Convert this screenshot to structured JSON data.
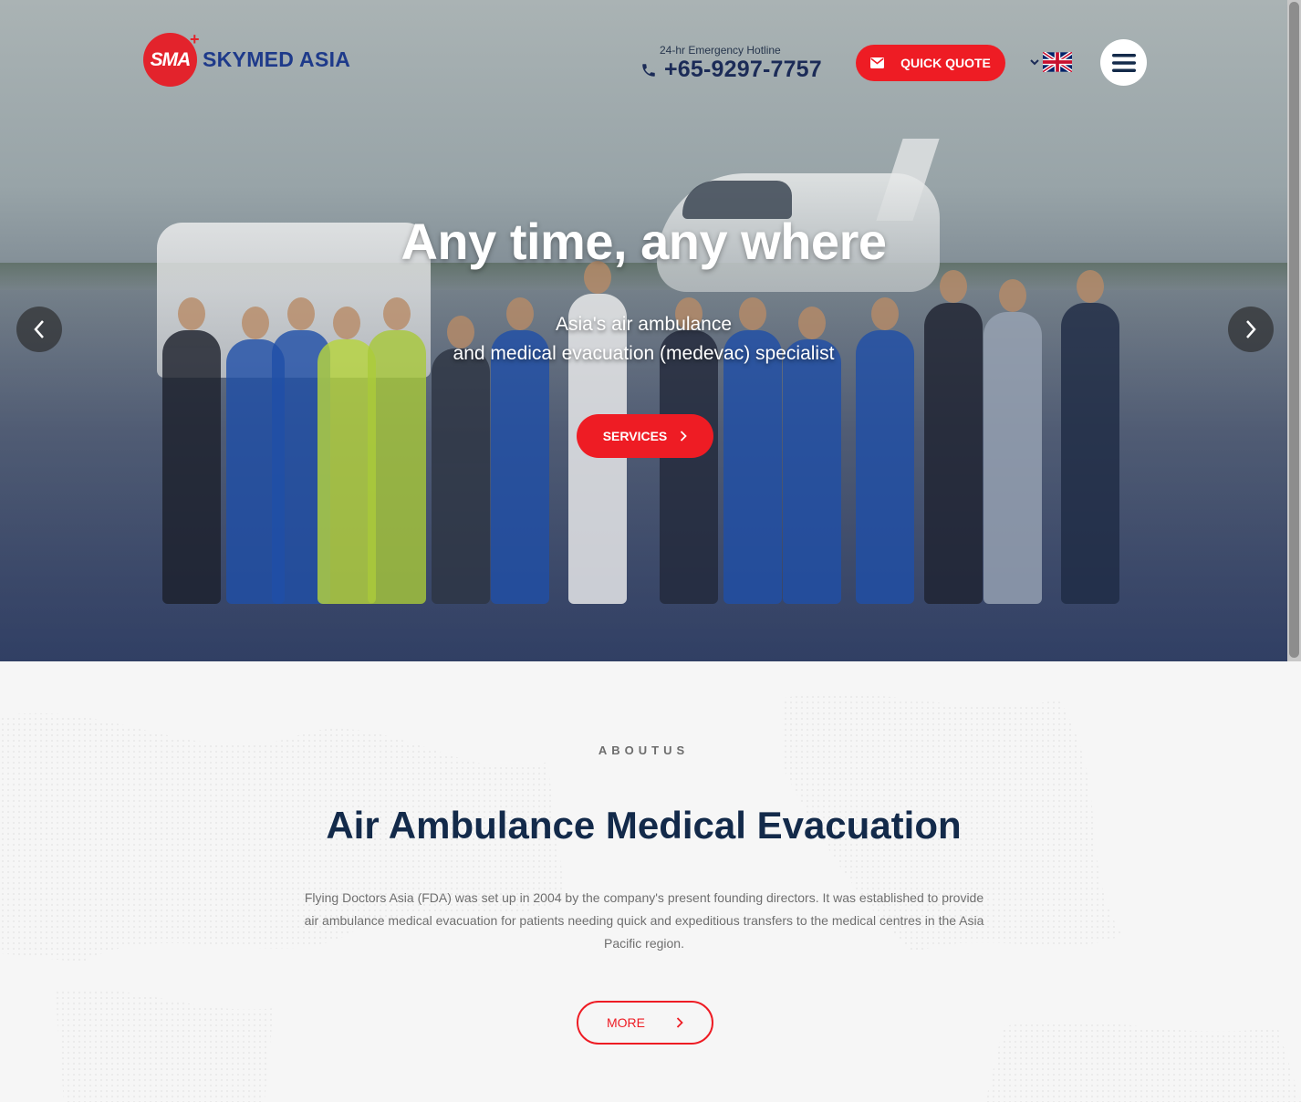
{
  "brand": {
    "logo_mark": "SMA",
    "logo_plus": "+",
    "name": "SKYMED ASIA"
  },
  "header": {
    "hotline_label": "24-hr Emergency Hotline",
    "hotline_number": "+65-9297-7757",
    "quote_label": "QUICK QUOTE",
    "language_icon": "uk-flag-icon",
    "menu_icon": "hamburger-icon"
  },
  "hero": {
    "title": "Any time, any where",
    "subtitle_line1": "Asia's air ambulance",
    "subtitle_line2": "and medical evacuation (medevac) specialist",
    "services_label": "SERVICES",
    "prev_icon": "chevron-left-icon",
    "next_icon": "chevron-right-icon"
  },
  "about": {
    "kicker": "ABOUTUS",
    "title": "Air Ambulance Medical Evacuation",
    "text": "Flying Doctors Asia (FDA) was set up in 2004 by the company's present founding directors. It was established to provide air ambulance medical evacuation for patients needing quick and expeditious transfers to the medical centres in the Asia Pacific region.",
    "more_label": "MORE"
  },
  "colors": {
    "accent": "#ee1c24",
    "brand_blue": "#1e3a8a",
    "heading": "#132a4a"
  }
}
